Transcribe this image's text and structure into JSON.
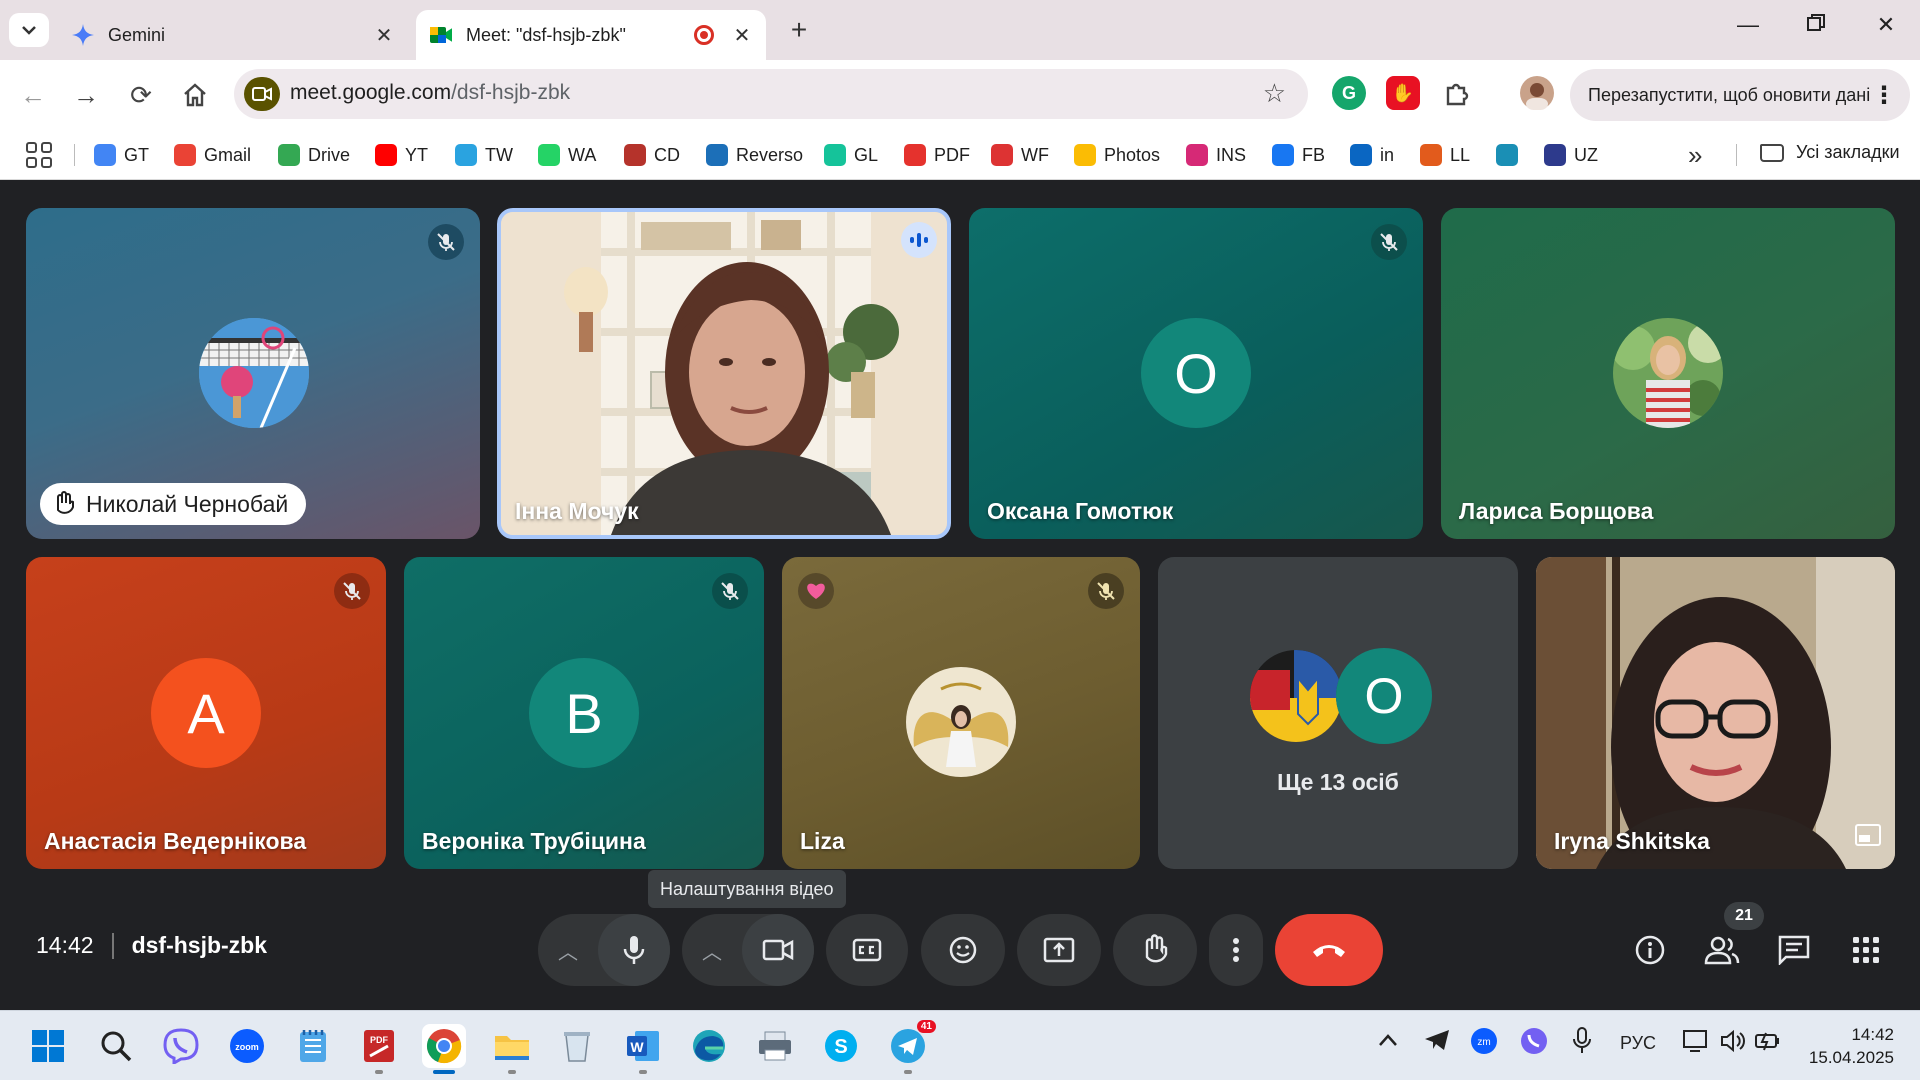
{
  "browser": {
    "tabs": [
      {
        "title": "Gemini",
        "active": false
      },
      {
        "title": "Meet: \"dsf-hsjb-zbk\"",
        "active": true
      }
    ],
    "url_host": "meet.google.com",
    "url_path": "/dsf-hsjb-zbk",
    "update_label": "Перезапустити, щоб оновити дані"
  },
  "bookmarks": [
    {
      "label": "GT",
      "color": "#4285f4"
    },
    {
      "label": "Gmail",
      "color": "#ea4335"
    },
    {
      "label": "Drive",
      "color": "#34a853"
    },
    {
      "label": "YT",
      "color": "#ff0000"
    },
    {
      "label": "TW",
      "color": "#2aa3e0"
    },
    {
      "label": "WA",
      "color": "#25d366"
    },
    {
      "label": "CD",
      "color": "#b5332b"
    },
    {
      "label": "Reverso",
      "color": "#1c6fb8"
    },
    {
      "label": "GL",
      "color": "#15c39a"
    },
    {
      "label": "PDF",
      "color": "#e5322d"
    },
    {
      "label": "WF",
      "color": "#d33"
    },
    {
      "label": "Photos",
      "color": "#fbbc04"
    },
    {
      "label": "INS",
      "color": "#d62976"
    },
    {
      "label": "FB",
      "color": "#1877f2"
    },
    {
      "label": "in",
      "color": "#0a66c2"
    },
    {
      "label": "LL",
      "color": "#e25b1c"
    },
    {
      "label": "",
      "color": "#1a8fb5"
    },
    {
      "label": "UZ",
      "color": "#2d3a8c"
    }
  ],
  "bookmarks_all": "Усі закладки",
  "meet": {
    "participants": [
      {
        "name": "Николай Чернобай",
        "hand_raised": true
      },
      {
        "name": "Інна Мочук",
        "speaking": true
      },
      {
        "name": "Оксана Гомотюк",
        "initial": "О",
        "color": "#12877a"
      },
      {
        "name": "Лариса Борщова"
      },
      {
        "name": "Анастасія Ведернікова",
        "initial": "А",
        "color": "#f4511e"
      },
      {
        "name": "Вероніка Трубіцина",
        "initial": "В",
        "color": "#12877a"
      },
      {
        "name": "Liza"
      },
      {
        "more_label": "Ще 13 осіб",
        "initial": "О",
        "color": "#12877a"
      },
      {
        "name": "Iryna Shkitska"
      }
    ],
    "tooltip": "Налаштування відео",
    "time": "14:42",
    "meeting_code": "dsf-hsjb-zbk",
    "people_count": "21"
  },
  "taskbar": {
    "telegram_badge": "41",
    "lang": "РУС",
    "clock_time": "14:42",
    "clock_date": "15.04.2025"
  }
}
